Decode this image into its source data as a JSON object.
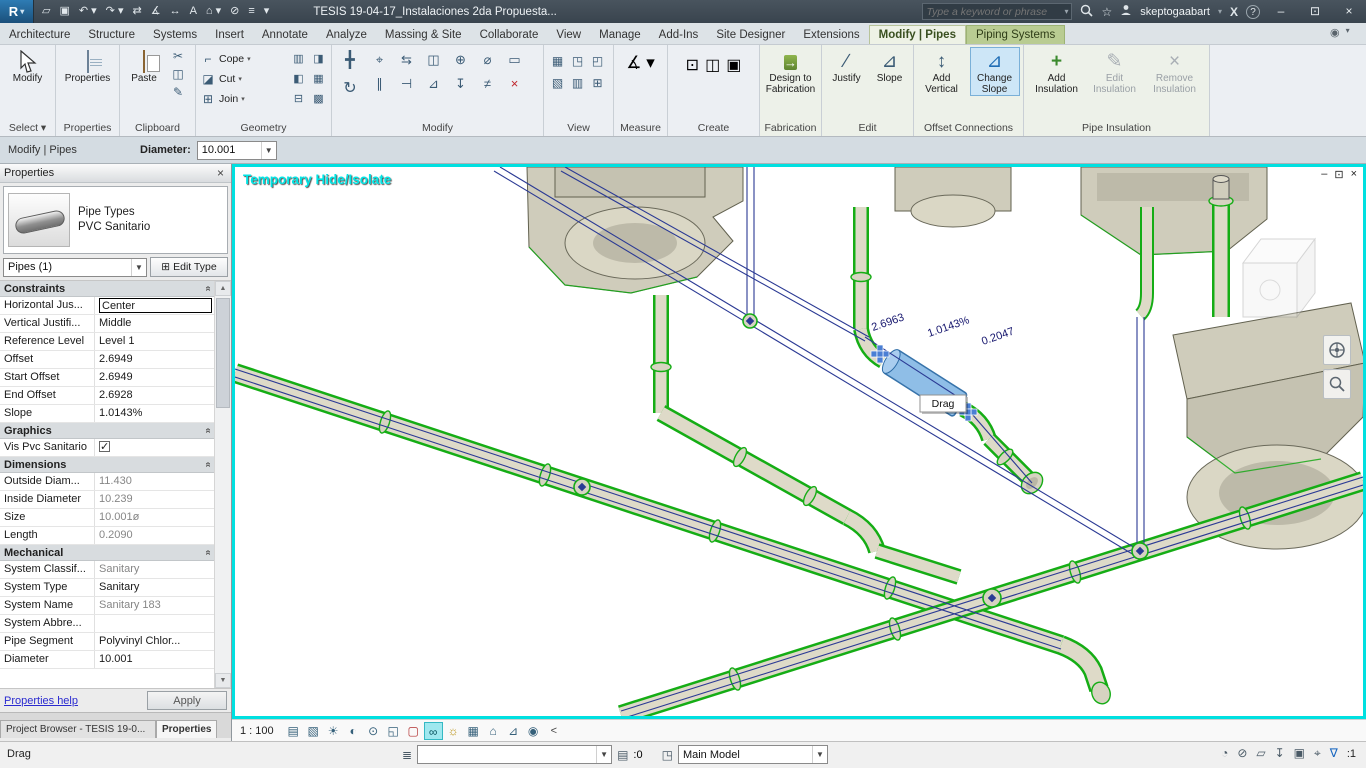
{
  "titlebar": {
    "app_letter": "R",
    "app_caret": "▾",
    "document_title": "TESIS 19-04-17_Instalaciones 2da Propuesta...",
    "search_placeholder": "Type a keyword or phrase",
    "username": "skeptogaabart",
    "exchange_glyph": "X",
    "help_glyph": "?",
    "qat_icons": [
      {
        "n": "open-icon",
        "g": "▱"
      },
      {
        "n": "save-icon",
        "g": "▣"
      },
      {
        "n": "undo-icon",
        "g": "↶ ▾"
      },
      {
        "n": "redo-icon",
        "g": "↷ ▾"
      },
      {
        "n": "transfer-icon",
        "g": "⇄"
      },
      {
        "n": "measure-icon",
        "g": "∡"
      },
      {
        "n": "aligned-dimension-icon",
        "g": "↔"
      },
      {
        "n": "text-icon",
        "g": "A"
      },
      {
        "n": "default-3d-view-icon",
        "g": "⌂ ▾"
      },
      {
        "n": "section-icon",
        "g": "⊘"
      },
      {
        "n": "thin-lines-icon",
        "g": "≡"
      },
      {
        "n": "qat-customize-icon",
        "g": "▾"
      }
    ],
    "window_controls": {
      "min": "–",
      "restore": "⊡",
      "close": "×"
    }
  },
  "ribbon": {
    "tabs": [
      {
        "label": "Architecture"
      },
      {
        "label": "Structure"
      },
      {
        "label": "Systems"
      },
      {
        "label": "Insert"
      },
      {
        "label": "Annotate"
      },
      {
        "label": "Analyze"
      },
      {
        "label": "Massing & Site"
      },
      {
        "label": "Collaborate"
      },
      {
        "label": "View"
      },
      {
        "label": "Manage"
      },
      {
        "label": "Add-Ins"
      },
      {
        "label": "Site Designer"
      },
      {
        "label": "Extensions"
      },
      {
        "label": "Modify | Pipes",
        "cls": "active"
      },
      {
        "label": "Piping Systems",
        "cls": "green"
      }
    ],
    "select_panel": {
      "label": "Select ▾",
      "modify_label": "Modify"
    },
    "properties_panel": {
      "label": "Properties",
      "button_label": "Properties"
    },
    "clipboard_panel": {
      "label": "Clipboard",
      "paste_label": "Paste",
      "icons": [
        {
          "n": "cut-icon",
          "g": "✂"
        },
        {
          "n": "copy-icon",
          "g": "◫"
        },
        {
          "n": "match-type-icon",
          "g": "✎"
        }
      ]
    },
    "geometry_panel": {
      "label": "Geometry",
      "rows": [
        {
          "label": "Cope",
          "glyph": "⌐",
          "e1": "▥",
          "e2": "◨"
        },
        {
          "label": "Cut",
          "glyph": "◪",
          "e1": "◧",
          "e2": "▦"
        },
        {
          "label": "Join",
          "glyph": "⊞",
          "e1": "⊟",
          "e2": "▩"
        }
      ]
    },
    "modify_panel": {
      "label": "Modify",
      "big": [
        {
          "n": "move-icon",
          "g": "╋"
        },
        {
          "n": "rotate-icon",
          "g": "↻"
        }
      ],
      "icons": [
        {
          "n": "align-icon",
          "g": "⌖"
        },
        {
          "n": "offset-icon",
          "g": "⇆"
        },
        {
          "n": "mirror-icon",
          "g": "◫"
        },
        {
          "n": "copy-icon",
          "g": "⊕"
        },
        {
          "n": "split-icon",
          "g": "⌀"
        },
        {
          "n": "array-icon",
          "g": "▭"
        },
        {
          "n": "scale-icon",
          "g": "∥"
        },
        {
          "n": "trim-icon",
          "g": "⊣"
        },
        {
          "n": "extend-icon",
          "g": "⊿"
        },
        {
          "n": "pin-icon",
          "g": "↧"
        },
        {
          "n": "unpin-icon",
          "g": "≠"
        },
        {
          "n": "delete-icon",
          "g": "×",
          "cls": "red"
        }
      ]
    },
    "view_panel": {
      "label": "View",
      "icons": [
        {
          "n": "visibility-icon",
          "g": "▦"
        },
        {
          "n": "filter-icon",
          "g": "◳"
        },
        {
          "n": "hide-icon",
          "g": "◰"
        },
        {
          "n": "override-icon",
          "g": "▧"
        },
        {
          "n": "linework-icon",
          "g": "▥"
        },
        {
          "n": "cut-profile-icon",
          "g": "⊞"
        }
      ]
    },
    "measure_panel": {
      "label": "Measure",
      "icons": [
        {
          "n": "measure-tool-icon",
          "g": "∡ ▾"
        }
      ]
    },
    "create_panel": {
      "label": "Create",
      "icons": [
        {
          "n": "create-group-icon",
          "g": "⊡"
        },
        {
          "n": "create-similar-icon",
          "g": "◫"
        },
        {
          "n": "create-assembly-icon",
          "g": "▣"
        }
      ]
    },
    "fabrication_panel": {
      "label": "Fabrication",
      "button_label": "Design to Fabrication",
      "icon_glyph": "→"
    },
    "edit_panel": {
      "label": "Edit",
      "justify_label": "Justify",
      "justify_glyph": "∕",
      "slope_label": "Slope",
      "slope_glyph": "⊿"
    },
    "offset_panel": {
      "label": "Offset Connections",
      "add_vertical_label": "Add Vertical",
      "add_vertical_glyph": "↕",
      "change_slope_label": "Change Slope",
      "change_slope_glyph": "⊿"
    },
    "insulation_panel": {
      "label": "Pipe Insulation",
      "add_label": "Add Insulation",
      "add_glyph": "+",
      "edit_label": "Edit Insulation",
      "edit_glyph": "✎",
      "remove_label": "Remove Insulation",
      "remove_glyph": "×"
    }
  },
  "options_bar": {
    "context_label": "Modify | Pipes",
    "diameter_label": "Diameter:",
    "diameter_value": "10.001"
  },
  "properties": {
    "header_title": "Properties",
    "close_glyph": "×",
    "type_name": "Pipe Types",
    "type_instance": "PVC Sanitario",
    "selection_label": "Pipes (1)",
    "edit_type_label": "Edit Type",
    "edit_type_icon": "⊞",
    "sections": [
      {
        "title": "Constraints",
        "rows": [
          {
            "name": "Horizontal Jus...",
            "value": "Center",
            "cls": "focus"
          },
          {
            "name": "Vertical Justifi...",
            "value": "Middle"
          },
          {
            "name": "Reference Level",
            "value": "Level 1"
          },
          {
            "name": "Offset",
            "value": "2.6949"
          },
          {
            "name": "Start Offset",
            "value": "2.6949"
          },
          {
            "name": "End Offset",
            "value": "2.6928"
          },
          {
            "name": "Slope",
            "value": "1.0143%"
          }
        ]
      },
      {
        "title": "Graphics",
        "rows": [
          {
            "name": "Vis Pvc Sanitario",
            "value": "",
            "cls": "chk"
          }
        ]
      },
      {
        "title": "Dimensions",
        "rows": [
          {
            "name": "Outside Diam...",
            "value": "11.430",
            "cls": "gray"
          },
          {
            "name": "Inside Diameter",
            "value": "10.239",
            "cls": "gray"
          },
          {
            "name": "Size",
            "value": "10.001ø",
            "cls": "gray"
          },
          {
            "name": "Length",
            "value": "0.2090",
            "cls": "gray"
          }
        ]
      },
      {
        "title": "Mechanical",
        "rows": [
          {
            "name": "System Classif...",
            "value": "Sanitary",
            "cls": "gray"
          },
          {
            "name": "System Type",
            "value": "Sanitary"
          },
          {
            "name": "System Name",
            "value": "Sanitary 183",
            "cls": "gray"
          },
          {
            "name": "System Abbre...",
            "value": "",
            "cls": "gray"
          },
          {
            "name": "Pipe Segment",
            "value": "Polyvinyl Chlor..."
          },
          {
            "name": "Diameter",
            "value": "10.001"
          }
        ]
      }
    ],
    "help_link": "Properties help",
    "apply_label": "Apply",
    "tabs": [
      "Project Browser - TESIS 19-0...",
      "Properties"
    ]
  },
  "viewport": {
    "overlay_label": "Temporary Hide/Isolate",
    "dimension_labels": [
      "2.6963",
      "1.0143%",
      "0.2047"
    ],
    "drag_tooltip": "Drag",
    "window_controls": {
      "min": "–",
      "restore": "⊡",
      "close": "×"
    }
  },
  "view_control_bar": {
    "scale_label": "1 : 100",
    "icons": [
      {
        "n": "detail-level-icon",
        "g": "▤"
      },
      {
        "n": "visual-style-icon",
        "g": "▧"
      },
      {
        "n": "sun-path-icon",
        "g": "☀"
      },
      {
        "n": "shadows-icon",
        "g": "◐"
      },
      {
        "n": "show-rendering-icon",
        "g": "⊙"
      },
      {
        "n": "crop-view-icon",
        "g": "◱"
      },
      {
        "n": "show-crop-region-icon",
        "g": "▢",
        "cls": "red"
      },
      {
        "n": "temporary-hide-isolate-icon",
        "g": "∞",
        "cls": "active"
      },
      {
        "n": "reveal-hidden-elements-icon",
        "g": "☼",
        "cls": "bulb"
      },
      {
        "n": "temporary-view-properties-icon",
        "g": "▦"
      },
      {
        "n": "worksharing-display-icon",
        "g": "⌂"
      },
      {
        "n": "analytical-model-icon",
        "g": "⊿"
      },
      {
        "n": "highlight-constraints-icon",
        "g": "◉"
      }
    ],
    "expand_glyph": "<"
  },
  "status_bar": {
    "hint": "Drag",
    "worksets_icon": {
      "n": "worksets-icon",
      "g": "≣"
    },
    "active_workset_value": "",
    "requests_icon": {
      "n": "editing-requests-icon",
      "g": "▤"
    },
    "requests_count": ":0",
    "design_options_icon": {
      "n": "design-options-icon",
      "g": "◳"
    },
    "design_option_value": "Main Model",
    "right_icons": [
      {
        "n": "background-processes-icon",
        "g": "◔"
      },
      {
        "n": "select-links-icon",
        "g": "⊘"
      },
      {
        "n": "select-underlay-icon",
        "g": "▱"
      },
      {
        "n": "select-pinned-icon",
        "g": "↧"
      },
      {
        "n": "select-by-face-icon",
        "g": "▣"
      },
      {
        "n": "drag-on-selection-icon",
        "g": "⌖"
      },
      {
        "n": "filter-icon",
        "g": "∇",
        "cls": "accent"
      }
    ],
    "selection_count": ":1"
  },
  "colors": {
    "selection_blue": "#8abbe6",
    "pipe_edge_green": "#15ad15",
    "hide_isolate_cyan": "#00e0e0",
    "contextual_tab_green": "#b9cc92"
  }
}
